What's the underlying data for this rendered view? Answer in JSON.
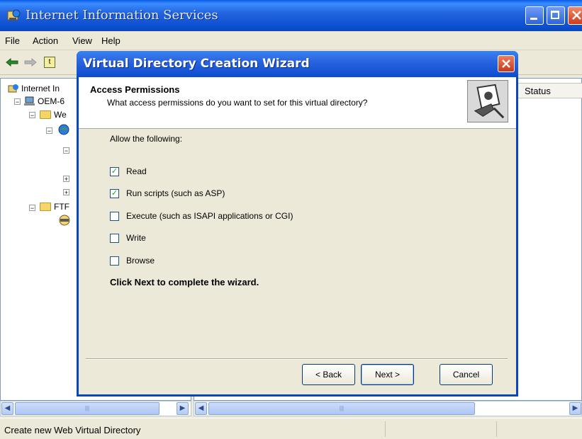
{
  "app": {
    "title": "Internet Information Services",
    "menu": [
      "File",
      "Action",
      "View",
      "Help"
    ]
  },
  "tree": {
    "items": [
      "Internet In",
      "OEM-6",
      "We",
      "FTF"
    ]
  },
  "list": {
    "columns": [
      "Status"
    ]
  },
  "status_bar": {
    "text": "Create new Web Virtual Directory"
  },
  "wizard": {
    "title": "Virtual Directory Creation Wizard",
    "header_title": "Access Permissions",
    "header_subtitle": "What access permissions do you want to set for this virtual directory?",
    "allow_label": "Allow the following:",
    "options": [
      {
        "label": "Read",
        "checked": true
      },
      {
        "label": "Run scripts (such as ASP)",
        "checked": true
      },
      {
        "label": "Execute (such as ISAPI applications or CGI)",
        "checked": false
      },
      {
        "label": "Write",
        "checked": false
      },
      {
        "label": "Browse",
        "checked": false
      }
    ],
    "footer_text": "Click Next to complete the wizard.",
    "buttons": {
      "back": "< Back",
      "next": "Next >",
      "cancel": "Cancel"
    }
  },
  "icons": {
    "back": "back-arrow-icon",
    "forward": "forward-arrow-icon",
    "close": "close-icon"
  },
  "colors": {
    "titlebar": "#0a5ce8",
    "check": "#21a121"
  }
}
